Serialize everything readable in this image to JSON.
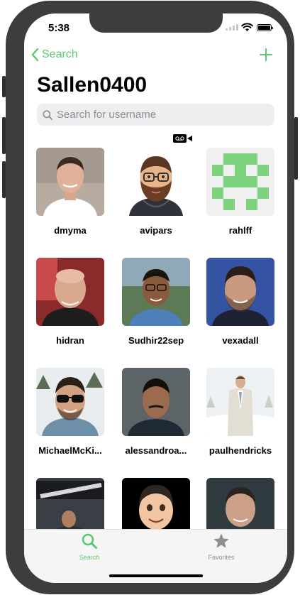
{
  "status_bar": {
    "time": "5:38"
  },
  "nav": {
    "back_label": "Search"
  },
  "page": {
    "title": "Sallen0400"
  },
  "search": {
    "placeholder": "Search for username"
  },
  "users": [
    {
      "username": "dmyma"
    },
    {
      "username": "avipars"
    },
    {
      "username": "rahlff"
    },
    {
      "username": "hidran"
    },
    {
      "username": "Sudhir22sep"
    },
    {
      "username": "vexadall"
    },
    {
      "username": "MichaelMcKi..."
    },
    {
      "username": "alessandroa..."
    },
    {
      "username": "paulhendricks"
    }
  ],
  "tabs": [
    {
      "label": "Search",
      "icon": "magnifier-icon",
      "active": true
    },
    {
      "label": "Favorites",
      "icon": "star-icon",
      "active": false
    }
  ],
  "colors": {
    "accent": "#5cc873",
    "inactive": "#8e8e93"
  }
}
